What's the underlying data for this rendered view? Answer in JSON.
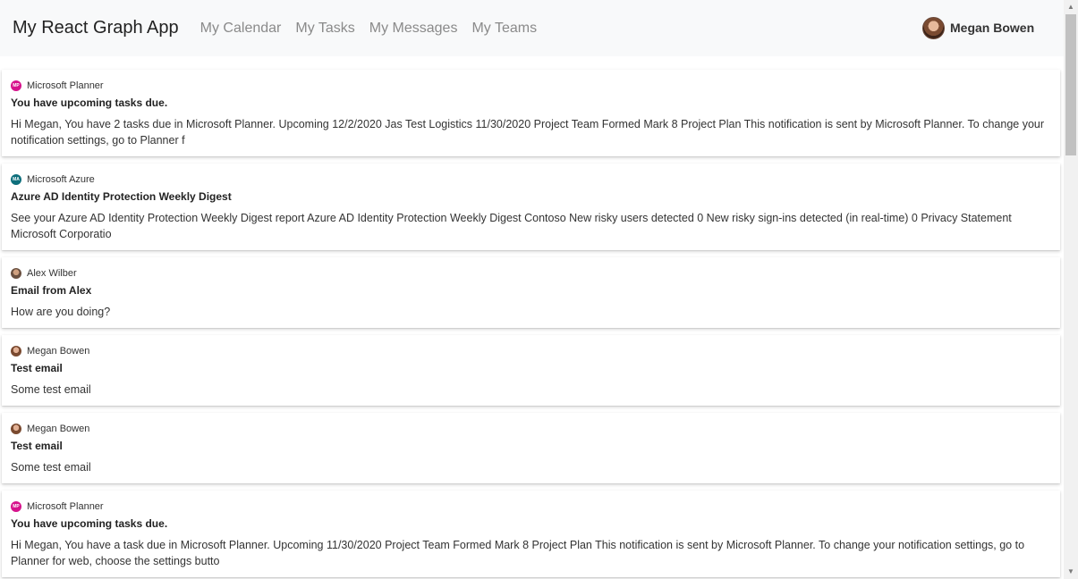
{
  "app": {
    "brand": "My React Graph App",
    "nav": [
      "My Calendar",
      "My Tasks",
      "My Messages",
      "My Teams"
    ],
    "user": "Megan Bowen"
  },
  "messages": [
    {
      "sender": "Microsoft Planner",
      "icon": "planner-icon",
      "initials": "MP",
      "subject": "You have upcoming tasks due.",
      "preview": "Hi Megan, You have 2 tasks due in Microsoft Planner. Upcoming 12/2/2020 Jas Test Logistics 11/30/2020 Project Team Formed Mark 8 Project Plan This notification is sent by Microsoft Planner. To change your notification settings, go to Planner f"
    },
    {
      "sender": "Microsoft Azure",
      "icon": "azure-icon",
      "initials": "MA",
      "subject": "Azure AD Identity Protection Weekly Digest",
      "preview": "See your Azure AD Identity Protection Weekly Digest report Azure AD Identity Protection Weekly Digest Contoso New risky users detected 0 New risky sign-ins detected (in real-time) 0 Privacy Statement Microsoft Corporatio"
    },
    {
      "sender": "Alex Wilber",
      "icon": "avatar-alex",
      "initials": "",
      "subject": "Email from Alex",
      "preview": "How are you doing?"
    },
    {
      "sender": "Megan Bowen",
      "icon": "avatar-megan",
      "initials": "",
      "subject": "Test email",
      "preview": "Some test email"
    },
    {
      "sender": "Megan Bowen",
      "icon": "avatar-megan",
      "initials": "",
      "subject": "Test email",
      "preview": "Some test email"
    },
    {
      "sender": "Microsoft Planner",
      "icon": "planner-icon",
      "initials": "MP",
      "subject": "You have upcoming tasks due.",
      "preview": "Hi Megan, You have a task due in Microsoft Planner. Upcoming 11/30/2020 Project Team Formed Mark 8 Project Plan This notification is sent by Microsoft Planner. To change your notification settings, go to Planner for web, choose the settings butto"
    }
  ]
}
